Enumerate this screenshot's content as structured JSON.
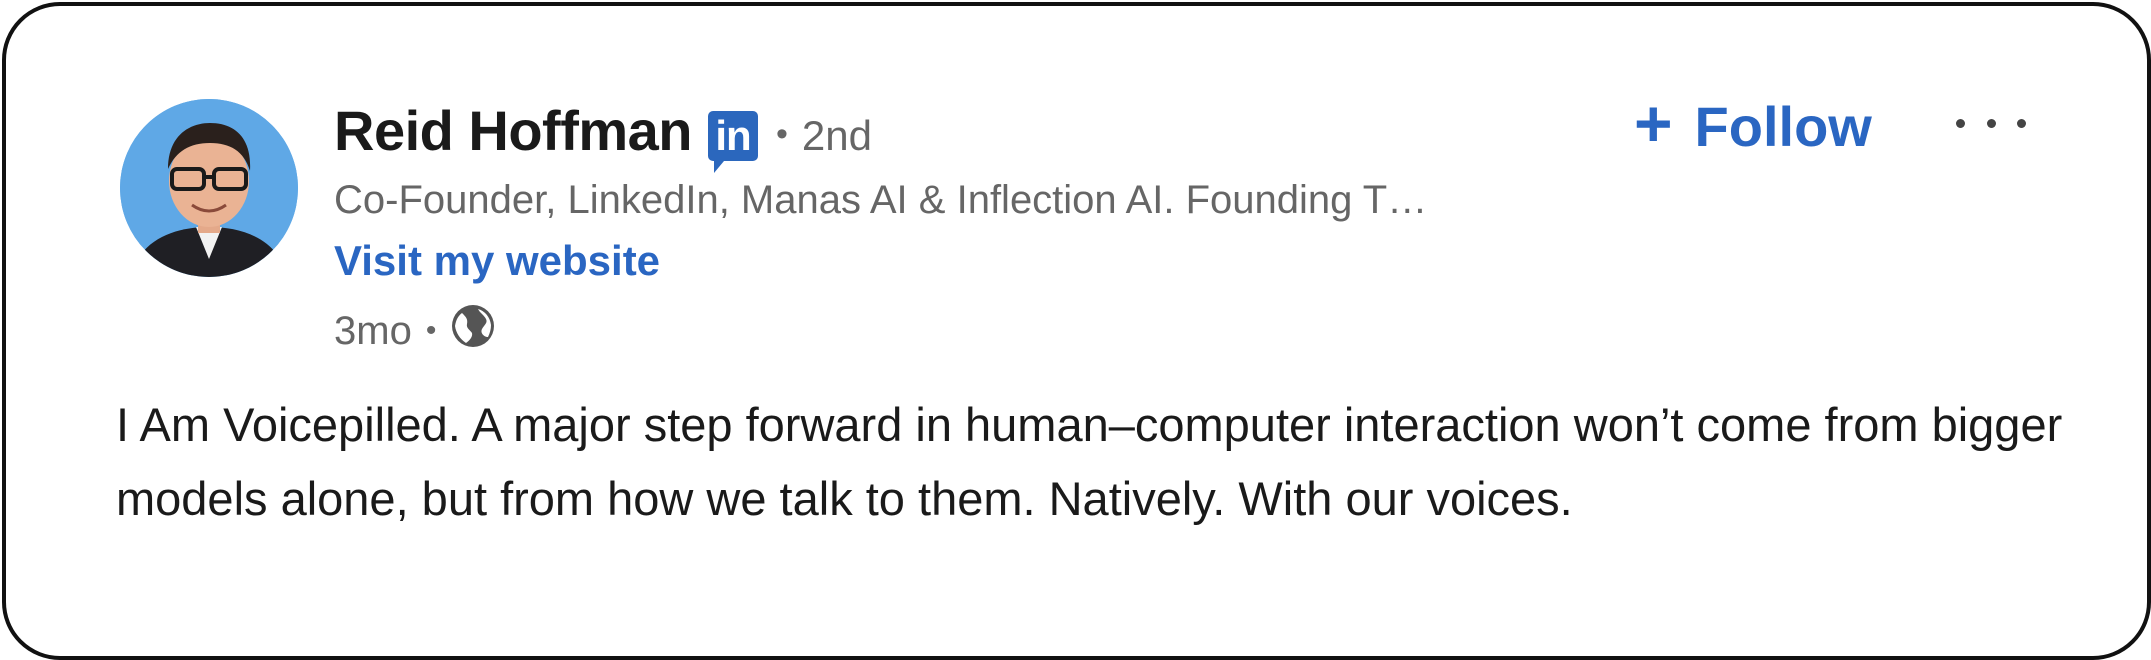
{
  "post": {
    "author": {
      "name": "Reid Hoffman",
      "badge_label": "in",
      "connection_separator": "•",
      "connection_degree": "2nd",
      "headline": "Co-Founder, LinkedIn, Manas AI & Inflection AI. Founding T…",
      "website_link": "Visit my website",
      "avatar_icon": "profile-photo"
    },
    "meta": {
      "time_ago": "3mo",
      "separator": "•",
      "visibility_icon": "globe-icon"
    },
    "actions": {
      "follow_icon": "+",
      "follow_label": "Follow",
      "more_icon": "ellipsis-icon"
    },
    "body_text": "I Am Voicepilled. A major step forward in human–computer interaction won’t come from bigger models alone, but from how we talk to them. Natively. With our voices."
  },
  "colors": {
    "brand_blue": "#2a66c2",
    "text_primary": "#1a1a1a",
    "text_secondary": "#666666",
    "border": "#111111"
  }
}
